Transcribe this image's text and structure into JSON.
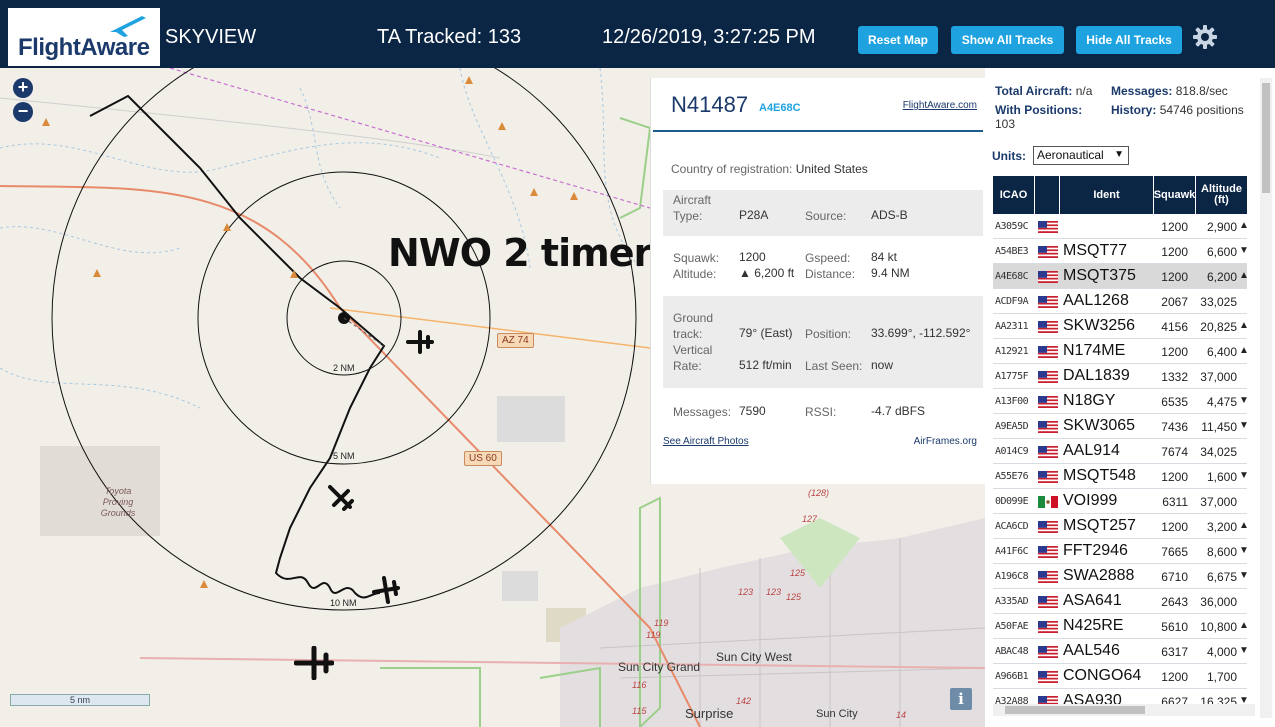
{
  "header": {
    "logo_text": "FlightAware",
    "brand": "SKYVIEW",
    "tracked": "TA Tracked: 133",
    "clock": "12/26/2019, 3:27:25 PM",
    "reset_label": "Reset Map",
    "show_label": "Show All Tracks",
    "hide_label": "Hide All Tracks",
    "accent": "#1fa3e0",
    "bar_color": "#0b2545"
  },
  "map": {
    "zoom_in": "+",
    "zoom_out": "−",
    "scale_label": "5 nm",
    "info": "i",
    "annotation": "NWO 2 timer",
    "rings": [
      "2 NM",
      "5 NM",
      "10 NM"
    ],
    "roads": {
      "az74": "AZ 74",
      "us60": "US 60"
    },
    "places": {
      "sun_city_grand": "Sun City Grand",
      "sun_city_west": "Sun City West",
      "surprise": "Surprise",
      "sun_city": "Sun City",
      "toyota": "Toyota Proving Grounds"
    },
    "route_numbers": [
      "(128)",
      "127",
      "125",
      "125",
      "123",
      "123",
      "119",
      "119",
      "116",
      "115",
      "142",
      "14",
      "(128)",
      "127"
    ]
  },
  "popup": {
    "registration": "N41487",
    "hex": "A4E68C",
    "link": "FlightAware.com",
    "country_label": "Country of registration:",
    "country": "United States",
    "aircraft_type_label": "Aircraft Type:",
    "aircraft_type": "P28A",
    "source_label": "Source:",
    "source": "ADS-B",
    "squawk_label": "Squawk:",
    "squawk": "1200",
    "gspeed_label": "Gspeed:",
    "gspeed": "84 kt",
    "altitude_label": "Altitude:",
    "altitude": "▲ 6,200 ft",
    "distance_label": "Distance:",
    "distance": "9.4 NM",
    "ground_track_label": "Ground track:",
    "ground_track": "79° (East)",
    "position_label": "Position:",
    "position": "33.699°, -112.592°",
    "vertical_rate_label": "Vertical Rate:",
    "vertical_rate": "512 ft/min",
    "last_seen_label": "Last Seen:",
    "last_seen": "now",
    "messages_label": "Messages:",
    "messages": "7590",
    "rssi_label": "RSSI:",
    "rssi": "-4.7 dBFS",
    "photos_link": "See Aircraft Photos",
    "airframes_link": "AirFrames.org"
  },
  "stats": {
    "total_label": "Total Aircraft:",
    "total": "n/a",
    "messages_label": "Messages:",
    "messages": "818.8/sec",
    "positions_label": "With Positions:",
    "positions": "103",
    "history_label": "History:",
    "history": "54746 positions",
    "units_label": "Units:",
    "units_value": "Aeronautical"
  },
  "table": {
    "headers": [
      "ICAO",
      "",
      "Ident",
      "Squawk",
      "Altitude (ft)"
    ],
    "rows": [
      {
        "icao": "A3059C",
        "flag": "us",
        "ident": "",
        "squawk": "1200",
        "alt": "2,900",
        "trend": "▲"
      },
      {
        "icao": "A54BE3",
        "flag": "us",
        "ident": "MSQT77",
        "squawk": "1200",
        "alt": "6,600",
        "trend": "▼"
      },
      {
        "icao": "A4E68C",
        "flag": "us",
        "ident": "MSQT375",
        "squawk": "1200",
        "alt": "6,200",
        "trend": "▲",
        "selected": true
      },
      {
        "icao": "ACDF9A",
        "flag": "us",
        "ident": "AAL1268",
        "squawk": "2067",
        "alt": "33,025",
        "trend": ""
      },
      {
        "icao": "AA2311",
        "flag": "us",
        "ident": "SKW3256",
        "squawk": "4156",
        "alt": "20,825",
        "trend": "▲"
      },
      {
        "icao": "A12921",
        "flag": "us",
        "ident": "N174ME",
        "squawk": "1200",
        "alt": "6,400",
        "trend": "▲"
      },
      {
        "icao": "A1775F",
        "flag": "us",
        "ident": "DAL1839",
        "squawk": "1332",
        "alt": "37,000",
        "trend": ""
      },
      {
        "icao": "A13F00",
        "flag": "us",
        "ident": "N18GY",
        "squawk": "6535",
        "alt": "4,475",
        "trend": "▼"
      },
      {
        "icao": "A9EA5D",
        "flag": "us",
        "ident": "SKW3065",
        "squawk": "7436",
        "alt": "11,450",
        "trend": "▼"
      },
      {
        "icao": "A014C9",
        "flag": "us",
        "ident": "AAL914",
        "squawk": "7674",
        "alt": "34,025",
        "trend": ""
      },
      {
        "icao": "A55E76",
        "flag": "us",
        "ident": "MSQT548",
        "squawk": "1200",
        "alt": "1,600",
        "trend": "▼"
      },
      {
        "icao": "0D099E",
        "flag": "mx",
        "ident": "VOI999",
        "squawk": "6311",
        "alt": "37,000",
        "trend": ""
      },
      {
        "icao": "ACA6CD",
        "flag": "us",
        "ident": "MSQT257",
        "squawk": "1200",
        "alt": "3,200",
        "trend": "▲"
      },
      {
        "icao": "A41F6C",
        "flag": "us",
        "ident": "FFT2946",
        "squawk": "7665",
        "alt": "8,600",
        "trend": "▼"
      },
      {
        "icao": "A196C8",
        "flag": "us",
        "ident": "SWA2888",
        "squawk": "6710",
        "alt": "6,675",
        "trend": "▼"
      },
      {
        "icao": "A335AD",
        "flag": "us",
        "ident": "ASA641",
        "squawk": "2643",
        "alt": "36,000",
        "trend": ""
      },
      {
        "icao": "A50FAE",
        "flag": "us",
        "ident": "N425RE",
        "squawk": "5610",
        "alt": "10,800",
        "trend": "▲"
      },
      {
        "icao": "ABAC48",
        "flag": "us",
        "ident": "AAL546",
        "squawk": "6317",
        "alt": "4,000",
        "trend": "▼"
      },
      {
        "icao": "A966B1",
        "flag": "us",
        "ident": "CONGO64",
        "squawk": "1200",
        "alt": "1,700",
        "trend": ""
      },
      {
        "icao": "A32A88",
        "flag": "us",
        "ident": "ASA930",
        "squawk": "6627",
        "alt": "16,325",
        "trend": "▼"
      }
    ]
  },
  "icons": {
    "gear": "gear-icon",
    "plane": "airplane-icon",
    "zoom_in": "plus-icon",
    "zoom_out": "minus-icon",
    "info": "info-icon"
  }
}
